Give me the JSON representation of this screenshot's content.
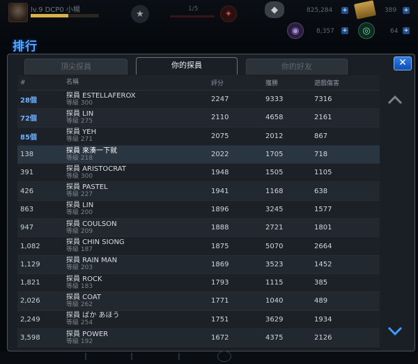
{
  "hud": {
    "player_name": "lv.9 DCP0 小楊",
    "energy_value": "1/5",
    "gems": "825,284",
    "scrolls": "389",
    "points": "8,357",
    "tokens": "64"
  },
  "title": "排行",
  "tabs": [
    "頂尖探員",
    "你的探員",
    "你的好友"
  ],
  "active_tab": 1,
  "close_label": "✕",
  "columns": [
    "#",
    "名稱",
    "評分",
    "獲勝",
    "遊戲傷害"
  ],
  "rows": [
    {
      "rank": "28個",
      "name": "探員 ESTELLAFEROX",
      "level": "等級 300",
      "score": "2247",
      "wins": "9333",
      "damage": "7316",
      "top": true
    },
    {
      "rank": "72個",
      "name": "探員 LIN",
      "level": "等級 275",
      "score": "2110",
      "wins": "4658",
      "damage": "2161",
      "top": true
    },
    {
      "rank": "85個",
      "name": "探員 YEH",
      "level": "等級 271",
      "score": "2075",
      "wins": "2012",
      "damage": "867",
      "top": true
    },
    {
      "rank": "138",
      "name": "探員 來湊一下就",
      "level": "等級 218",
      "score": "2022",
      "wins": "1705",
      "damage": "718",
      "self": true
    },
    {
      "rank": "391",
      "name": "探員 ARISTOCRAT",
      "level": "等級 300",
      "score": "1948",
      "wins": "1505",
      "damage": "1105"
    },
    {
      "rank": "426",
      "name": "探員 PASTEL",
      "level": "等級 227",
      "score": "1941",
      "wins": "1168",
      "damage": "638"
    },
    {
      "rank": "863",
      "name": "探員 LIN",
      "level": "等級 200",
      "score": "1896",
      "wins": "3245",
      "damage": "1577"
    },
    {
      "rank": "947",
      "name": "探員 COULSON",
      "level": "等級 209",
      "score": "1888",
      "wins": "2721",
      "damage": "1801"
    },
    {
      "rank": "1,082",
      "name": "探員 CHIN SIONG",
      "level": "等級 187",
      "score": "1875",
      "wins": "5070",
      "damage": "2664"
    },
    {
      "rank": "1,129",
      "name": "探員 RAIN MAN",
      "level": "等級 203",
      "score": "1869",
      "wins": "3523",
      "damage": "1452"
    },
    {
      "rank": "1,821",
      "name": "探員 ROCK",
      "level": "等級 183",
      "score": "1793",
      "wins": "1115",
      "damage": "385"
    },
    {
      "rank": "2,026",
      "name": "探員 COAT",
      "level": "等級 262",
      "score": "1771",
      "wins": "1040",
      "damage": "489"
    },
    {
      "rank": "2,249",
      "name": "探員 ばか あほう",
      "level": "等級 254",
      "score": "1751",
      "wins": "3629",
      "damage": "1934"
    },
    {
      "rank": "3,598",
      "name": "探員 POWER",
      "level": "等級 192",
      "score": "1672",
      "wins": "4375",
      "damage": "2126"
    }
  ],
  "colors": {
    "accent": "#5aa6ff",
    "top_rank": "#6fb0ff",
    "panel": "#1a1f26"
  },
  "icons": {
    "star": "star-icon",
    "energy": "energy-icon",
    "gem": "gem-icon",
    "scroll": "scroll-icon",
    "scroll_up": "chevron-up-icon",
    "scroll_down": "chevron-down-icon"
  }
}
